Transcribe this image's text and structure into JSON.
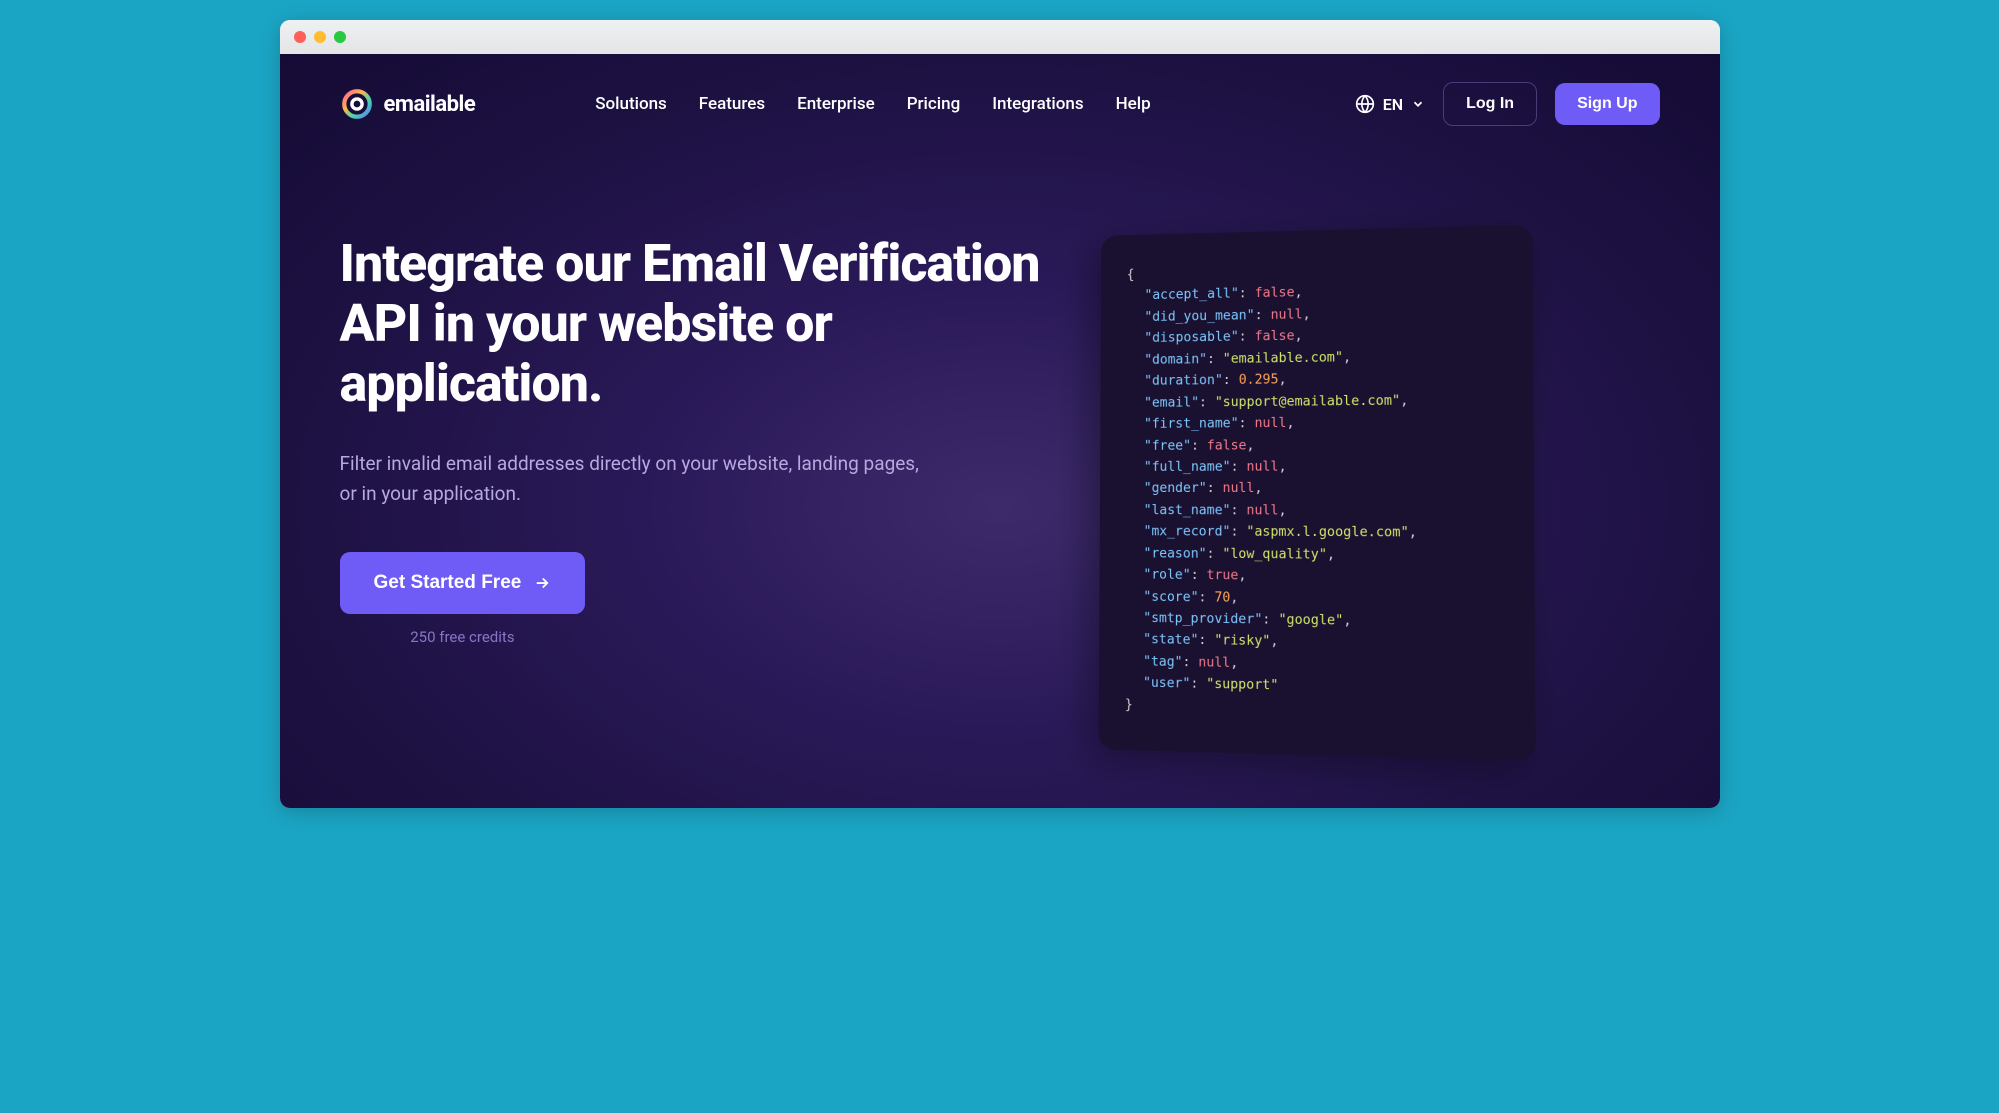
{
  "brand": {
    "name": "emailable"
  },
  "nav": {
    "links": [
      "Solutions",
      "Features",
      "Enterprise",
      "Pricing",
      "Integrations",
      "Help"
    ],
    "language": "EN",
    "login": "Log In",
    "signup": "Sign Up"
  },
  "hero": {
    "headline": "Integrate our Email Verification API in your website or application.",
    "subhead": "Filter invalid email addresses directly on your website, landing pages, or in your application.",
    "cta": "Get Started Free",
    "credits_note": "250 free credits"
  },
  "code": {
    "open": "{",
    "close": "}",
    "lines": [
      {
        "key": "\"accept_all\"",
        "sep": ": ",
        "val": "false",
        "vclass": "b",
        "trail": ","
      },
      {
        "key": "\"did_you_mean\"",
        "sep": ": ",
        "val": "null",
        "vclass": "b",
        "trail": ","
      },
      {
        "key": "\"disposable\"",
        "sep": ": ",
        "val": "false",
        "vclass": "b",
        "trail": ","
      },
      {
        "key": "\"domain\"",
        "sep": ": ",
        "val": "\"emailable.com\"",
        "vclass": "s",
        "trail": ","
      },
      {
        "key": "\"duration\"",
        "sep": ": ",
        "val": "0.295",
        "vclass": "n",
        "trail": ","
      },
      {
        "key": "\"email\"",
        "sep": ": ",
        "val": "\"support@emailable.com\"",
        "vclass": "s",
        "trail": ","
      },
      {
        "key": "\"first_name\"",
        "sep": ": ",
        "val": "null",
        "vclass": "b",
        "trail": ","
      },
      {
        "key": "\"free\"",
        "sep": ": ",
        "val": "false",
        "vclass": "b",
        "trail": ","
      },
      {
        "key": "\"full_name\"",
        "sep": ": ",
        "val": "null",
        "vclass": "b",
        "trail": ","
      },
      {
        "key": "\"gender\"",
        "sep": ": ",
        "val": "null",
        "vclass": "b",
        "trail": ","
      },
      {
        "key": "\"last_name\"",
        "sep": ": ",
        "val": "null",
        "vclass": "b",
        "trail": ","
      },
      {
        "key": "\"mx_record\"",
        "sep": ": ",
        "val": "\"aspmx.l.google.com\"",
        "vclass": "s",
        "trail": ","
      },
      {
        "key": "\"reason\"",
        "sep": ": ",
        "val": "\"low_quality\"",
        "vclass": "s",
        "trail": ","
      },
      {
        "key": "\"role\"",
        "sep": ": ",
        "val": "true",
        "vclass": "b",
        "trail": ","
      },
      {
        "key": "\"score\"",
        "sep": ": ",
        "val": "70",
        "vclass": "n",
        "trail": ","
      },
      {
        "key": "\"smtp_provider\"",
        "sep": ": ",
        "val": "\"google\"",
        "vclass": "s",
        "trail": ","
      },
      {
        "key": "\"state\"",
        "sep": ": ",
        "val": "\"risky\"",
        "vclass": "s",
        "trail": ","
      },
      {
        "key": "\"tag\"",
        "sep": ": ",
        "val": "null",
        "vclass": "b",
        "trail": ","
      },
      {
        "key": "\"user\"",
        "sep": ": ",
        "val": "\"support\"",
        "vclass": "s",
        "trail": ""
      }
    ]
  }
}
